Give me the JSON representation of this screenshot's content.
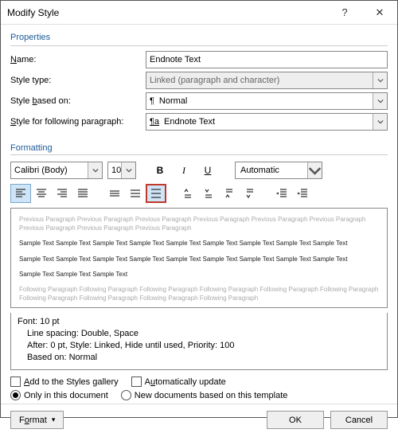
{
  "window": {
    "title": "Modify Style",
    "help": "?",
    "close": "✕"
  },
  "properties": {
    "heading": "Properties",
    "name_label_pre": "",
    "name_u": "N",
    "name_label_post": "ame:",
    "name_value": "Endnote Text",
    "type_label": "Style type:",
    "type_value": "Linked (paragraph and character)",
    "based_pre": "Style ",
    "based_u": "b",
    "based_post": "ased on:",
    "based_value": "Normal",
    "follow_pre": "",
    "follow_u": "S",
    "follow_post": "tyle for following paragraph:",
    "follow_value": "Endnote Text"
  },
  "formatting": {
    "heading": "Formatting",
    "font": "Calibri (Body)",
    "size": "10",
    "bold": "B",
    "italic": "I",
    "underline": "U",
    "color": "Automatic"
  },
  "preview": {
    "prev_para": "Previous Paragraph Previous Paragraph Previous Paragraph Previous Paragraph Previous Paragraph Previous Paragraph Previous Paragraph Previous Paragraph Previous Paragraph",
    "sample1": "Sample Text Sample Text Sample Text Sample Text Sample Text Sample Text Sample Text Sample Text Sample Text",
    "sample2": "Sample Text Sample Text Sample Text Sample Text Sample Text Sample Text Sample Text Sample Text Sample Text",
    "sample3": "Sample Text Sample Text Sample Text",
    "follow_para": "Following Paragraph Following Paragraph Following Paragraph Following Paragraph Following Paragraph Following Paragraph Following Paragraph Following Paragraph Following Paragraph Following Paragraph"
  },
  "details": {
    "l1": "Font: 10 pt",
    "l2": "Line spacing:  Double, Space",
    "l3": "After:  0 pt, Style: Linked, Hide until used, Priority: 100",
    "l4": "Based on: Normal"
  },
  "options": {
    "add_gallery_pre": "",
    "add_gallery_u": "A",
    "add_gallery_post": "dd to the Styles gallery",
    "auto_update_pre": "A",
    "auto_update_u": "u",
    "auto_update_post": "tomatically update",
    "only_doc": "Only in this document",
    "new_docs": "New documents based on this template"
  },
  "footer": {
    "format_pre": "F",
    "format_u": "o",
    "format_post": "rmat",
    "ok": "OK",
    "cancel": "Cancel"
  }
}
